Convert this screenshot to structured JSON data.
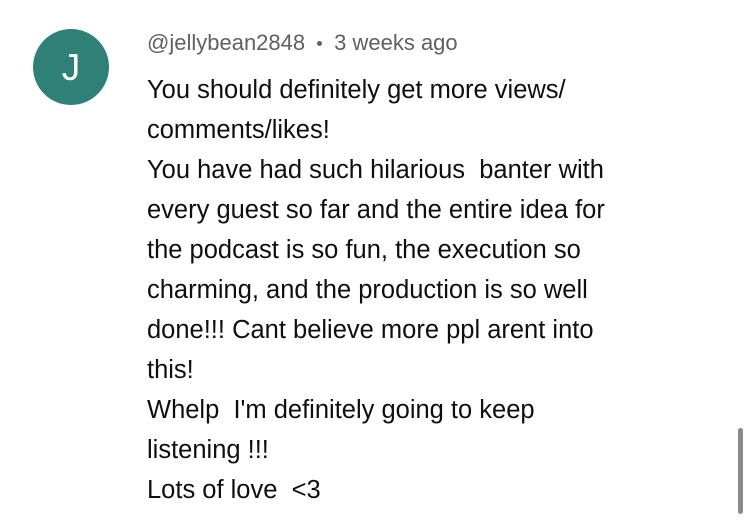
{
  "comment": {
    "avatar_letter": "J",
    "avatar_color": "#2f8077",
    "username": "@jellybean2848",
    "separator": "•",
    "timestamp": "3 weeks ago",
    "lines": [
      "You should definitely get more views/",
      "comments/likes!",
      "You have had such hilarious  banter with",
      "every guest so far and the entire idea for",
      "the podcast is so fun, the execution so",
      "charming, and the production is so well",
      "done!!! Cant believe more ppl arent into",
      "this!",
      "Whelp  I'm definitely going to keep",
      "listening !!!",
      "Lots of love  <3"
    ]
  }
}
